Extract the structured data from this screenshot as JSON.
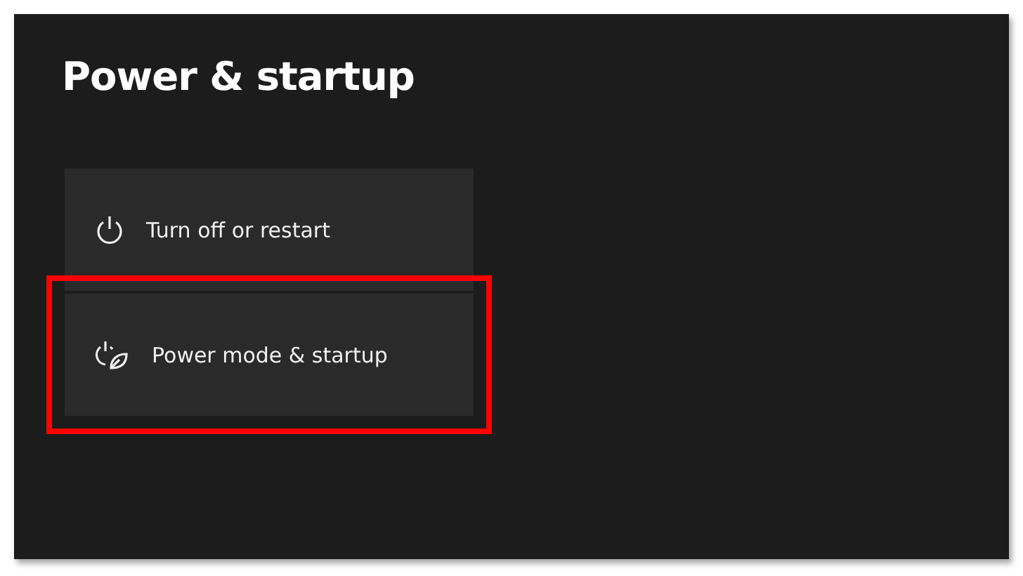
{
  "page": {
    "title": "Power & startup"
  },
  "menu": [
    {
      "label": "Turn off or restart",
      "kind": "power",
      "highlighted": false
    },
    {
      "label": "Power mode & startup",
      "kind": "power-leaf",
      "highlighted": true
    }
  ]
}
